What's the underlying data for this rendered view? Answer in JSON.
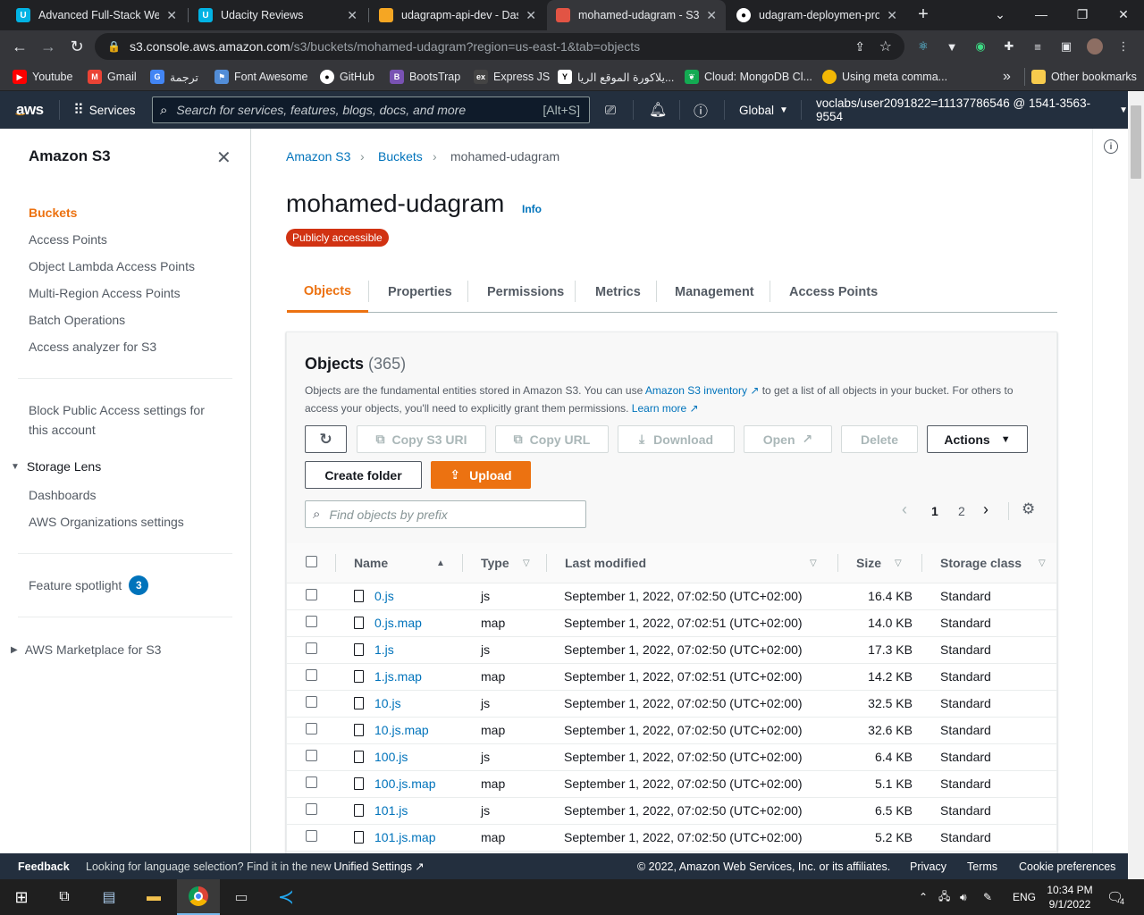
{
  "browser": {
    "tabs": [
      {
        "title": "Advanced Full-Stack Web",
        "icon": "udacity-icon",
        "color": "#02b3e4"
      },
      {
        "title": "Udacity Reviews",
        "icon": "udacity-icon",
        "color": "#02b3e4"
      },
      {
        "title": "udagrapm-api-dev - Dash",
        "icon": "beanstalk-icon",
        "color": "#f5a623"
      },
      {
        "title": "mohamed-udagram - S3",
        "icon": "s3-icon",
        "color": "#e25444"
      },
      {
        "title": "udagram-deploymen-pro",
        "icon": "github-icon",
        "color": "#ffffff"
      }
    ],
    "new_tab": "+",
    "url_host": "s3.console.aws.amazon.com",
    "url_path": "/s3/buckets/mohamed-udagram?region=us-east-1&tab=objects",
    "bookmarks": [
      {
        "label": "Youtube",
        "color": "#ff0000"
      },
      {
        "label": "Gmail",
        "color": "#ea4335"
      },
      {
        "label": "ترجمة",
        "color": "#4285f4"
      },
      {
        "label": "Font Awesome",
        "color": "#528dd7"
      },
      {
        "label": "GitHub",
        "color": "#ffffff"
      },
      {
        "label": "BootsTrap",
        "color": "#7952b3"
      },
      {
        "label": "Express JS",
        "color": "#444444"
      },
      {
        "label": "يلاكورة الموقع الريا...",
        "color": "#000000"
      },
      {
        "label": "Cloud: MongoDB Cl...",
        "color": "#13aa52"
      },
      {
        "label": "Using meta comma...",
        "color": "#f2b705"
      }
    ],
    "bookmarks_overflow": "»",
    "other_bookmarks": "Other bookmarks"
  },
  "aws_header": {
    "logo": "aws",
    "services": "Services",
    "search_placeholder": "Search for services, features, blogs, docs, and more",
    "search_shortcut": "[Alt+S]",
    "region": "Global",
    "account": "voclabs/user2091822=11137786546 @ 1541-3563-9554"
  },
  "sidebar": {
    "title": "Amazon S3",
    "items": [
      {
        "label": "Buckets",
        "active": true
      },
      {
        "label": "Access Points"
      },
      {
        "label": "Object Lambda Access Points"
      },
      {
        "label": "Multi-Region Access Points"
      },
      {
        "label": "Batch Operations"
      },
      {
        "label": "Access analyzer for S3"
      }
    ],
    "block_public": "Block Public Access settings for this account",
    "storage_lens": "Storage Lens",
    "storage_lens_items": [
      "Dashboards",
      "AWS Organizations settings"
    ],
    "feature_spotlight": "Feature spotlight",
    "feature_spotlight_count": "3",
    "marketplace": "AWS Marketplace for S3"
  },
  "breadcrumb": [
    "Amazon S3",
    "Buckets",
    "mohamed-udagram"
  ],
  "bucket": {
    "name": "mohamed-udagram",
    "info": "Info",
    "access_badge": "Publicly accessible"
  },
  "tabs": [
    "Objects",
    "Properties",
    "Permissions",
    "Metrics",
    "Management",
    "Access Points"
  ],
  "objects_panel": {
    "heading": "Objects",
    "count": "(365)",
    "desc_1": "Objects are the fundamental entities stored in Amazon S3. You can use ",
    "desc_link_1": "Amazon S3 inventory",
    "desc_2": " to get a list of all objects in your bucket. For others to access your objects, you'll need to explicitly grant them permissions. ",
    "desc_link_2": "Learn more",
    "buttons": {
      "copy_uri": "Copy S3 URI",
      "copy_url": "Copy URL",
      "download": "Download",
      "open": "Open",
      "delete": "Delete",
      "actions": "Actions",
      "create_folder": "Create folder",
      "upload": "Upload"
    },
    "find_placeholder": "Find objects by prefix",
    "pages": [
      "1",
      "2"
    ],
    "columns": [
      "Name",
      "Type",
      "Last modified",
      "Size",
      "Storage class"
    ],
    "rows": [
      {
        "name": "0.js",
        "type": "js",
        "modified": "September 1, 2022, 07:02:50 (UTC+02:00)",
        "size": "16.4 KB",
        "class": "Standard"
      },
      {
        "name": "0.js.map",
        "type": "map",
        "modified": "September 1, 2022, 07:02:51 (UTC+02:00)",
        "size": "14.0 KB",
        "class": "Standard"
      },
      {
        "name": "1.js",
        "type": "js",
        "modified": "September 1, 2022, 07:02:50 (UTC+02:00)",
        "size": "17.3 KB",
        "class": "Standard"
      },
      {
        "name": "1.js.map",
        "type": "map",
        "modified": "September 1, 2022, 07:02:51 (UTC+02:00)",
        "size": "14.2 KB",
        "class": "Standard"
      },
      {
        "name": "10.js",
        "type": "js",
        "modified": "September 1, 2022, 07:02:50 (UTC+02:00)",
        "size": "32.5 KB",
        "class": "Standard"
      },
      {
        "name": "10.js.map",
        "type": "map",
        "modified": "September 1, 2022, 07:02:50 (UTC+02:00)",
        "size": "32.6 KB",
        "class": "Standard"
      },
      {
        "name": "100.js",
        "type": "js",
        "modified": "September 1, 2022, 07:02:50 (UTC+02:00)",
        "size": "6.4 KB",
        "class": "Standard"
      },
      {
        "name": "100.js.map",
        "type": "map",
        "modified": "September 1, 2022, 07:02:50 (UTC+02:00)",
        "size": "5.1 KB",
        "class": "Standard"
      },
      {
        "name": "101.js",
        "type": "js",
        "modified": "September 1, 2022, 07:02:50 (UTC+02:00)",
        "size": "6.5 KB",
        "class": "Standard"
      },
      {
        "name": "101.js.map",
        "type": "map",
        "modified": "September 1, 2022, 07:02:50 (UTC+02:00)",
        "size": "5.2 KB",
        "class": "Standard"
      }
    ]
  },
  "footer": {
    "feedback": "Feedback",
    "lang_text": "Looking for language selection? Find it in the new ",
    "lang_link": "Unified Settings",
    "copyright": "© 2022, Amazon Web Services, Inc. or its affiliates.",
    "privacy": "Privacy",
    "terms": "Terms",
    "cookies": "Cookie preferences"
  },
  "taskbar": {
    "lang": "ENG",
    "time": "10:34 PM",
    "date": "9/1/2022",
    "notifications": "4"
  }
}
